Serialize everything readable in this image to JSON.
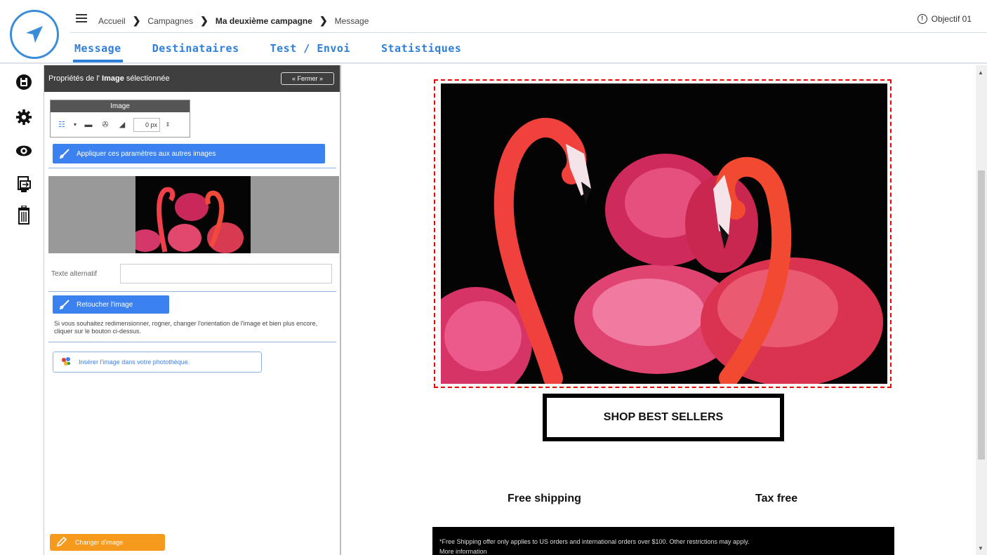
{
  "header": {
    "breadcrumb": [
      "Accueil",
      "Campagnes",
      "Ma deuxième campagne",
      "Message"
    ],
    "user_name": "Objectif 01",
    "tabs": [
      "Message",
      "Destinataires",
      "Test / Envoi",
      "Statistiques"
    ],
    "active_tab": "Message"
  },
  "sidebar": {
    "icons": [
      "save-icon",
      "settings-icon",
      "preview-icon",
      "export-icon",
      "trash-icon"
    ]
  },
  "panel": {
    "title_pre": "Propriétés de l'",
    "title_bold": "Image",
    "title_post": "sélectionnée",
    "close_label": "« Fermer »",
    "toolbar_title": "Image",
    "border_value": "0 px",
    "apply_label": "Appliquer ces paramètres aux autres images",
    "alt_label": "Texte alternatif",
    "alt_value": "",
    "retouch_label": "Retoucher l'image",
    "retouch_help": "Si vous souhaitez redimensionner, rogner, changer l'orientation de l'image et bien plus encore, cliquer sur le bouton ci-dessus.",
    "insert_label": "Insérer l'image dans votre photothèque.",
    "change_label": "Changer d'image"
  },
  "email": {
    "shop_button": "SHOP BEST SELLERS",
    "feature_left": "Free shipping",
    "feature_right": "Tax free",
    "footer_text": "*Free Shipping offer only applies to US orders and international orders over $100. Other restrictions may apply.",
    "footer_link": "More information"
  },
  "colors": {
    "accent_blue": "#3b82f0",
    "tab_blue": "#2f7fd8",
    "orange": "#f59a1d",
    "selection_red": "#e00000"
  }
}
